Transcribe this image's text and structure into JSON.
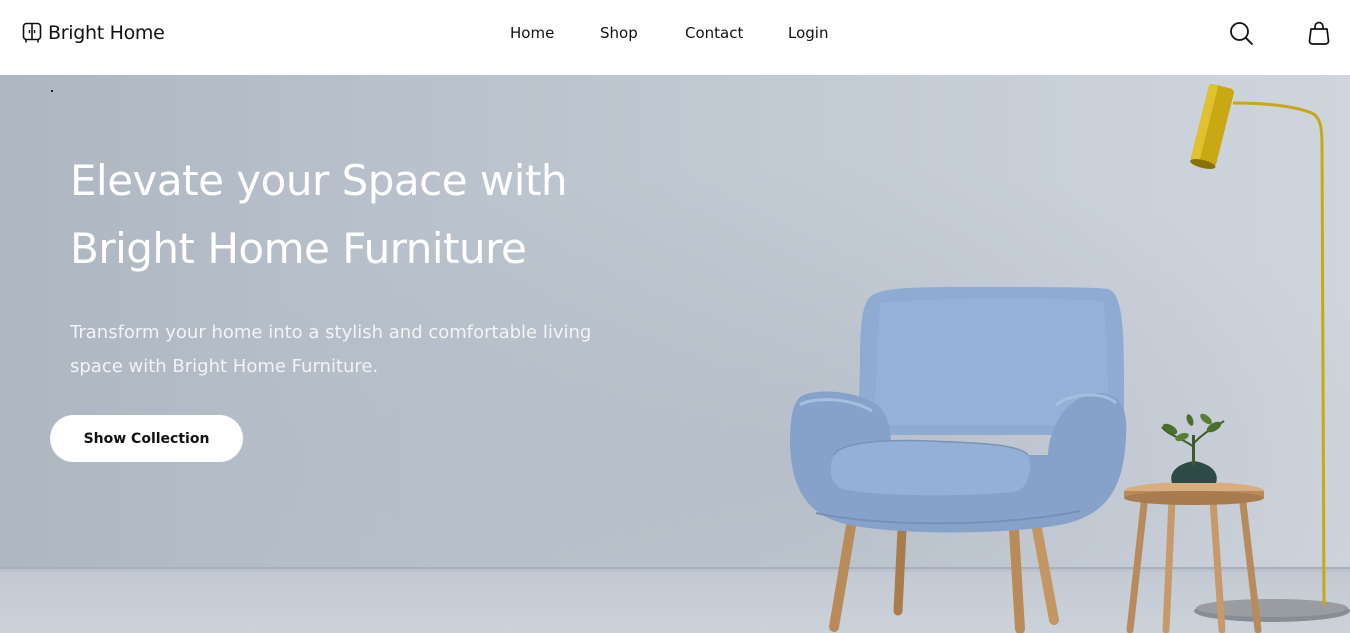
{
  "header": {
    "brand": "Bright Home",
    "brand_icon": "wardrobe-icon",
    "nav": [
      {
        "label": "Home"
      },
      {
        "label": "Shop"
      },
      {
        "label": "Contact"
      },
      {
        "label": "Login"
      }
    ],
    "icons": {
      "search": "search-icon",
      "cart": "shopping-bag-icon"
    }
  },
  "hero": {
    "title_lines": [
      "Elevate your Space with",
      "Bright Home Furniture"
    ],
    "subtitle_lines": [
      "Transform your home into a stylish and comfortable living",
      "space with Bright Home Furniture."
    ],
    "cta_label": "Show Collection"
  },
  "colors": {
    "chair": "#8fabd2",
    "lamp": "#c9a814",
    "wood": "#c8996a"
  }
}
